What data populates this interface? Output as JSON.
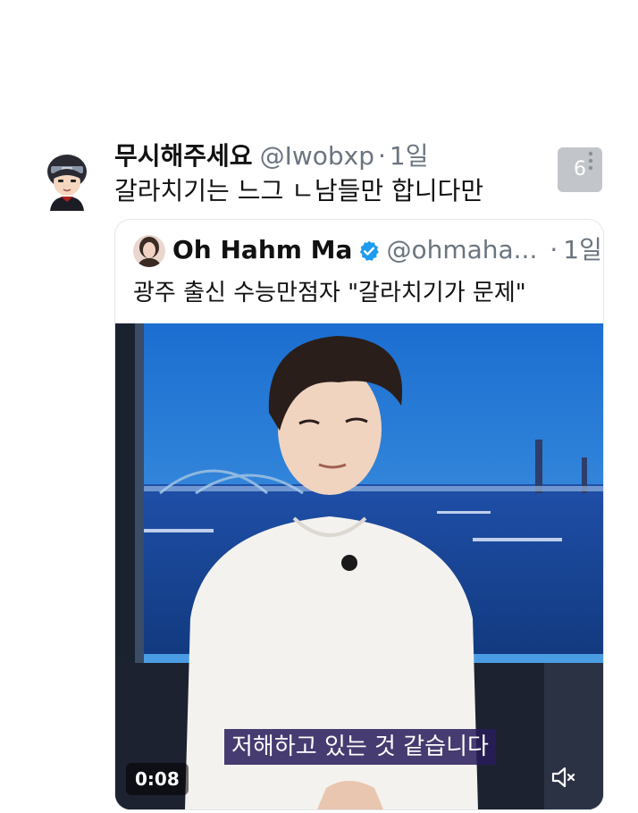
{
  "tweet": {
    "display_name": "무시해주세요",
    "handle": "@Iwobxp",
    "separator": "·",
    "time": "1일",
    "text": "갈라치기는 느그 ㄴ남들만 합니다만",
    "more_count": "6",
    "avatar_icon": "avatar-icon"
  },
  "quote": {
    "display_name": "Oh Hahm Ma",
    "handle": "@ohmaha...",
    "separator": "·",
    "time": "1일",
    "text": "광주 출신 수능만점자 \"갈라치기가 문제\"",
    "verified_icon": "verified-badge-icon",
    "verified_color": "#1d9bf0",
    "media": {
      "subtitle": "저해하고 있는 것 같습니다",
      "duration": "0:08",
      "mute_icon": "mute-icon"
    }
  },
  "colors": {
    "text": "#0f1419",
    "secondary": "#6b7580",
    "border": "#e2e6ea",
    "badge": "#c2c6ca"
  }
}
